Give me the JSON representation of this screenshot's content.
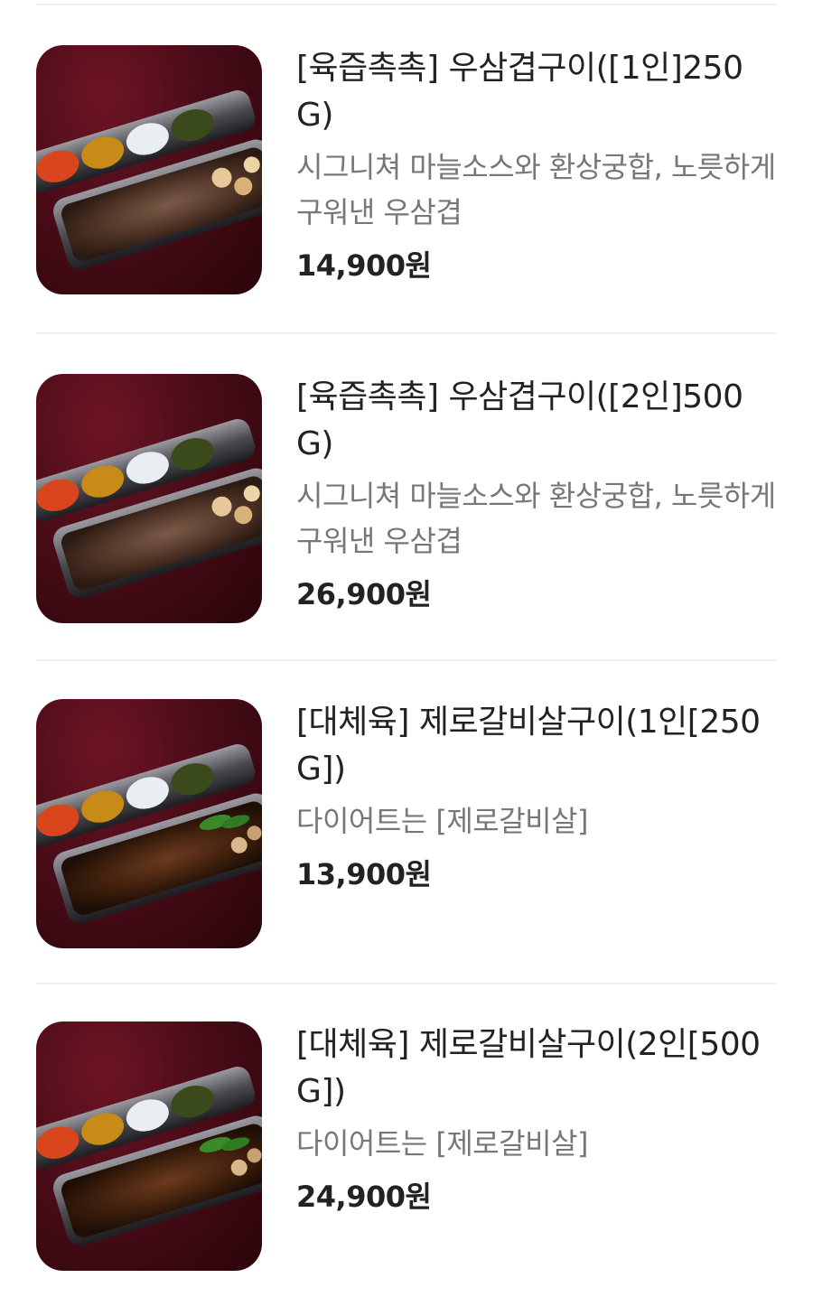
{
  "menu_items": [
    {
      "name": "[육즙촉촉] 우삼겹구이([1인]250G)",
      "description": "시그니쳐 마늘소스와 환상궁합, 노릇하게 구워낸 우삼겹",
      "price": "14,900원",
      "image_icon": "wusamgyeop-lunchbox-photo"
    },
    {
      "name": "[육즙촉촉] 우삼겹구이([2인]500G)",
      "description": "시그니쳐 마늘소스와 환상궁합, 노릇하게 구워낸 우삼겹",
      "price": "26,900원",
      "image_icon": "wusamgyeop-lunchbox-photo"
    },
    {
      "name": "[대체육] 제로갈비살구이(1인[250G])",
      "description": "다이어트는 [제로갈비살]",
      "price": "13,900원",
      "image_icon": "zero-galbi-lunchbox-photo"
    },
    {
      "name": "[대체육] 제로갈비살구이(2인[500G])",
      "description": "다이어트는 [제로갈비살]",
      "price": "24,900원",
      "image_icon": "zero-galbi-lunchbox-photo"
    }
  ],
  "colors": {
    "background_cloth": "#4a0c18",
    "divider": "#f0f0f0",
    "title_text": "#222222",
    "desc_text": "#777777"
  }
}
